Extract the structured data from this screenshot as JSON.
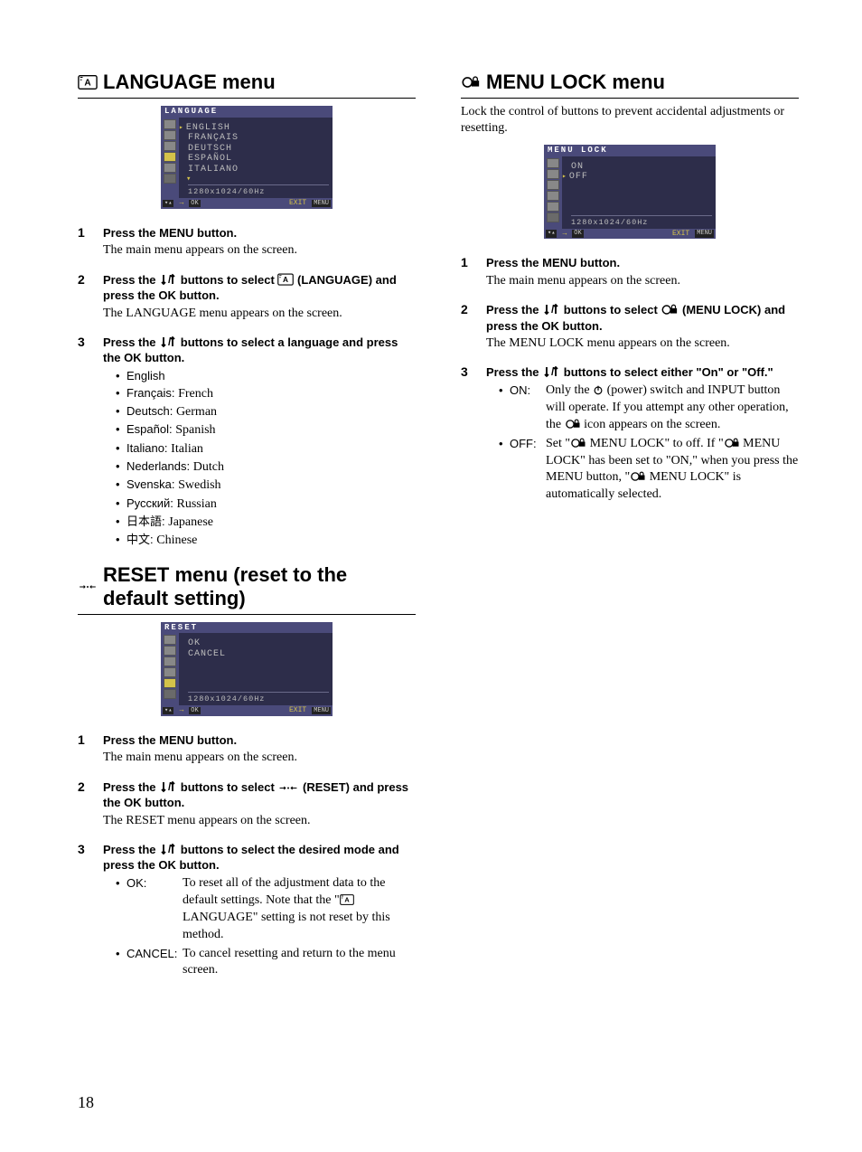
{
  "page_number": "18",
  "left": {
    "language": {
      "title": "LANGUAGE menu",
      "osd": {
        "title": "LANGUAGE",
        "items": [
          "ENGLISH",
          "FRANÇAIS",
          "DEUTSCH",
          "ESPAÑOL",
          "ITALIANO"
        ],
        "status": "1280x1024/60Hz",
        "footer_ok": "OK",
        "footer_exit": "EXIT",
        "footer_menu": "MENU"
      },
      "steps": [
        {
          "head": "Press the MENU button.",
          "body": "The main menu appears on the screen."
        },
        {
          "head_pre": "Press the ",
          "head_mid": " buttons to select ",
          "head_post": " (LANGUAGE) and press the OK button.",
          "body": "The LANGUAGE menu appears on the screen."
        },
        {
          "head_pre": "Press the ",
          "head_post": " buttons to select a language and press the OK button.",
          "langs": [
            {
              "term": "English",
              "desc": ""
            },
            {
              "term": "Français:",
              "desc": "French"
            },
            {
              "term": "Deutsch:",
              "desc": "German"
            },
            {
              "term": "Español:",
              "desc": "Spanish"
            },
            {
              "term": "Italiano:",
              "desc": "Italian"
            },
            {
              "term": "Nederlands:",
              "desc": "Dutch"
            },
            {
              "term": "Svenska:",
              "desc": "Swedish"
            },
            {
              "term": "Русский:",
              "desc": "Russian"
            },
            {
              "term": "日本語:",
              "desc": "Japanese"
            },
            {
              "term": "中文:",
              "desc": "Chinese"
            }
          ]
        }
      ]
    },
    "reset": {
      "title": "RESET menu (reset to the default setting)",
      "osd": {
        "title": "RESET",
        "items": [
          "OK",
          "CANCEL"
        ],
        "status": "1280x1024/60Hz",
        "footer_ok": "OK",
        "footer_exit": "EXIT",
        "footer_menu": "MENU"
      },
      "steps": [
        {
          "head": "Press the MENU button.",
          "body": "The main menu appears on the screen."
        },
        {
          "head_pre": "Press the ",
          "head_mid": " buttons to select ",
          "head_post": " (RESET) and press the OK button.",
          "body": "The RESET menu appears on the screen."
        },
        {
          "head_pre": "Press the ",
          "head_post": " buttons to select the desired mode and press the OK button.",
          "defs": [
            {
              "term": "OK:",
              "desc_pre": "To reset all of the adjustment data to the default settings. Note that the \"",
              "desc_post": " LANGUAGE\" setting is not reset by this method."
            },
            {
              "term": "CANCEL:",
              "desc": "To cancel resetting and return to the menu screen."
            }
          ]
        }
      ]
    }
  },
  "right": {
    "menulock": {
      "title": "MENU LOCK menu",
      "intro": "Lock the control of buttons to prevent accidental adjustments or resetting.",
      "osd": {
        "title": "MENU  LOCK",
        "items": [
          "ON",
          "OFF"
        ],
        "status": "1280x1024/60Hz",
        "footer_ok": "OK",
        "footer_exit": "EXIT",
        "footer_menu": "MENU"
      },
      "steps": [
        {
          "head": "Press the MENU button.",
          "body": "The main menu appears on the screen."
        },
        {
          "head_pre": "Press the ",
          "head_mid": " buttons to select ",
          "head_post": " (MENU LOCK) and press the OK button.",
          "body": "The MENU LOCK menu appears on the screen."
        },
        {
          "head_pre": "Press the ",
          "head_post": " buttons to select either \"On\" or \"Off.\"",
          "defs": [
            {
              "term": "ON:",
              "desc_pre": "Only the ",
              "desc_mid": " (power) switch and INPUT button will operate. If you attempt any other operation, the ",
              "desc_post": " icon appears on the screen."
            },
            {
              "term": "OFF:",
              "desc_a": "Set \"",
              "desc_b": " MENU LOCK\" to off. If \"",
              "desc_c": " MENU LOCK\" has been set to \"ON,\" when you press the MENU button, \"",
              "desc_d": " MENU LOCK\" is automatically selected."
            }
          ]
        }
      ]
    }
  }
}
